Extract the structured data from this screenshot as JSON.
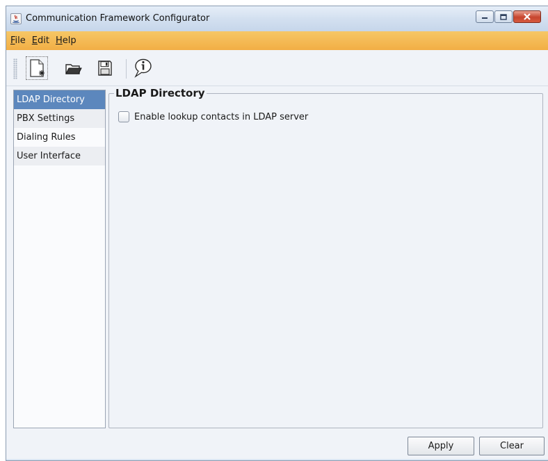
{
  "window": {
    "title": "Communication Framework Configurator"
  },
  "menu": {
    "items": [
      {
        "key": "F",
        "rest": "ile"
      },
      {
        "key": "E",
        "rest": "dit"
      },
      {
        "key": "H",
        "rest": "elp"
      }
    ]
  },
  "toolbar": {
    "buttons": [
      {
        "icon": "new-document-icon",
        "selected": true
      },
      {
        "icon": "open-folder-icon",
        "selected": false
      },
      {
        "icon": "save-icon",
        "selected": false
      },
      {
        "icon": "info-balloon-icon",
        "selected": false
      }
    ]
  },
  "sidebar": {
    "items": [
      {
        "label": "LDAP Directory",
        "selected": true
      },
      {
        "label": "PBX Settings",
        "selected": false
      },
      {
        "label": "Dialing Rules",
        "selected": false
      },
      {
        "label": "User Interface",
        "selected": false
      }
    ]
  },
  "panel": {
    "title": "LDAP Directory",
    "checkbox_label": "Enable lookup contacts in LDAP server",
    "checkbox_checked": false
  },
  "footer": {
    "apply_label": "Apply",
    "clear_label": "Clear"
  },
  "colors": {
    "menubar": "#f2ae45",
    "selection": "#5c87bd",
    "close_button": "#c7452e"
  }
}
